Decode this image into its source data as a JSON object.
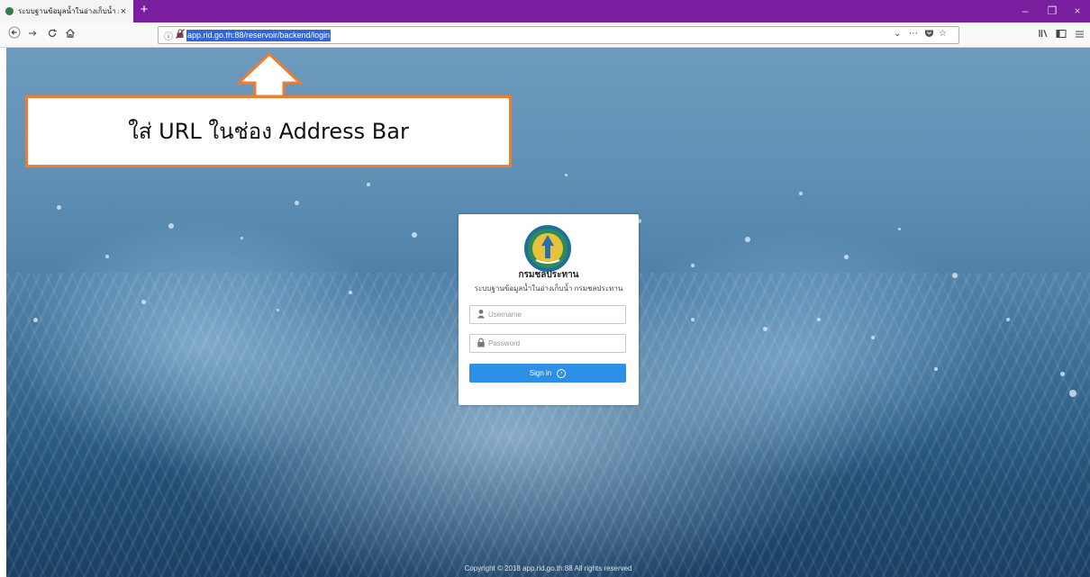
{
  "browser": {
    "tab_title": "ระบบฐานข้อมูลน้ำในอ่างเก็บน้ำ กร",
    "tab_close": "×",
    "new_tab": "+",
    "url": "app.rid.go.th:88/reservoir/backend/login",
    "info_icon": "ⓘ",
    "window_controls": [
      "–",
      "❐",
      "×"
    ]
  },
  "callout": {
    "text": "ใส่ URL ในช่อง Address Bar",
    "border_color": "#ed7d31"
  },
  "login": {
    "org_name": "กรมชลประทาน",
    "system_name": "ระบบฐานข้อมูลน้ำในอ่างเก็บน้ำ กรมชลประทาน",
    "username_placeholder": "Username",
    "password_placeholder": "Password",
    "signin_label": "Sign in",
    "signin_color": "#2e8fe6"
  },
  "footer": {
    "copyright": "Copyright © 2018 app.rid.go.th:88 All rights reserved"
  },
  "icons": {
    "favicon": "globe-icon",
    "back": "back-arrow-icon",
    "forward": "forward-arrow-icon",
    "reload": "reload-icon",
    "home": "home-icon",
    "dropdown": "chevron-down-icon",
    "more": "ellipsis-icon",
    "pocket": "pocket-icon",
    "bookmark": "star-icon",
    "library": "library-icon",
    "sidebar": "sidebar-icon",
    "menu": "hamburger-menu-icon",
    "user": "user-icon",
    "lock": "lock-icon",
    "go": "arrow-circle-icon"
  }
}
